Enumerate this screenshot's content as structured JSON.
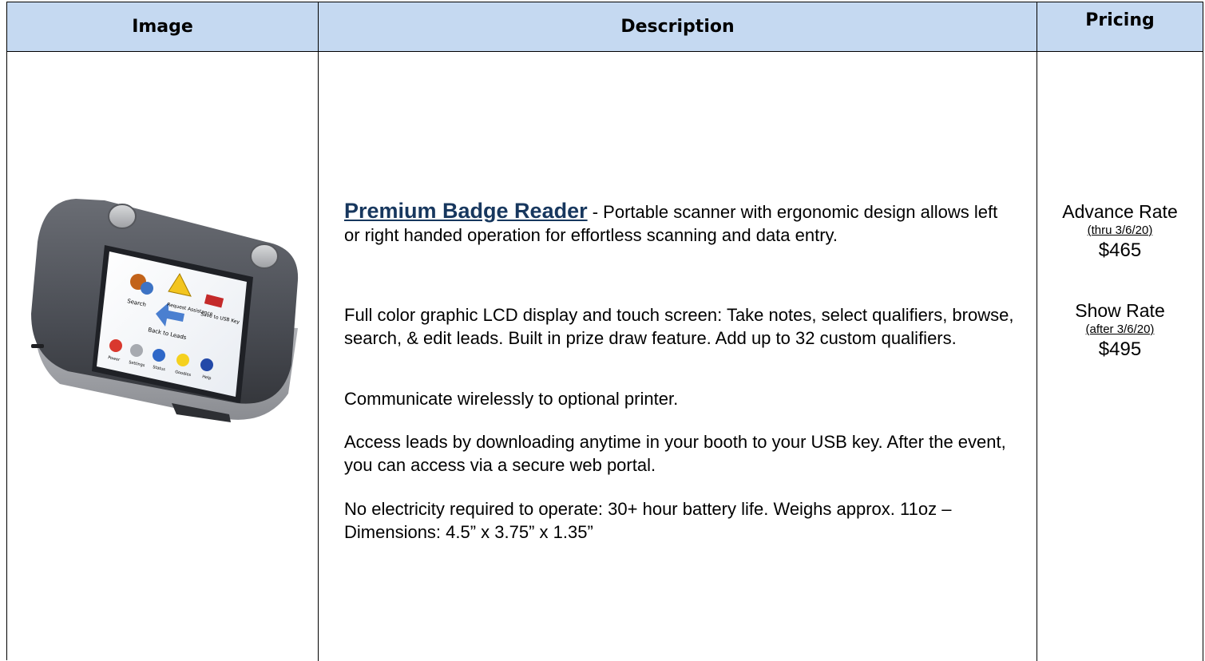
{
  "headers": {
    "image": "Image",
    "description": "Description",
    "pricing": "Pricing"
  },
  "product": {
    "name": "Premium Badge Reader",
    "intro": " - Portable scanner with  ergonomic design allows left or right handed operation for effortless scanning and data entry.",
    "paragraphs": [
      "Full color graphic LCD display and touch screen:  Take notes, select qualifiers, browse, search, & edit leads.  Built in prize draw feature.  Add up to 32 custom qualifiers.",
      "Communicate wirelessly to optional printer.",
      "Access leads by downloading anytime in your booth to your USB key.  After the event, you can access via a secure web portal.",
      "No electricity required to operate: 30+ hour battery life.  Weighs approx. 11oz – Dimensions: 4.5” x 3.75” x 1.35”"
    ],
    "device_screen": {
      "search": "Search",
      "request": "Request Assistance",
      "save": "Save to USB Key",
      "back": "Back to Leads",
      "power": "Power",
      "settings": "Settings",
      "status": "Status",
      "goodies": "Goodies",
      "help": "Help"
    }
  },
  "pricing": {
    "advance": {
      "label": "Advance Rate",
      "note": "(thru 3/6/20)",
      "value": "$465"
    },
    "show": {
      "label": "Show Rate",
      "note": "(after 3/6/20)",
      "value": "$495"
    }
  },
  "colors": {
    "header_bg": "#c5d9f1",
    "product_name": "#17375e"
  }
}
